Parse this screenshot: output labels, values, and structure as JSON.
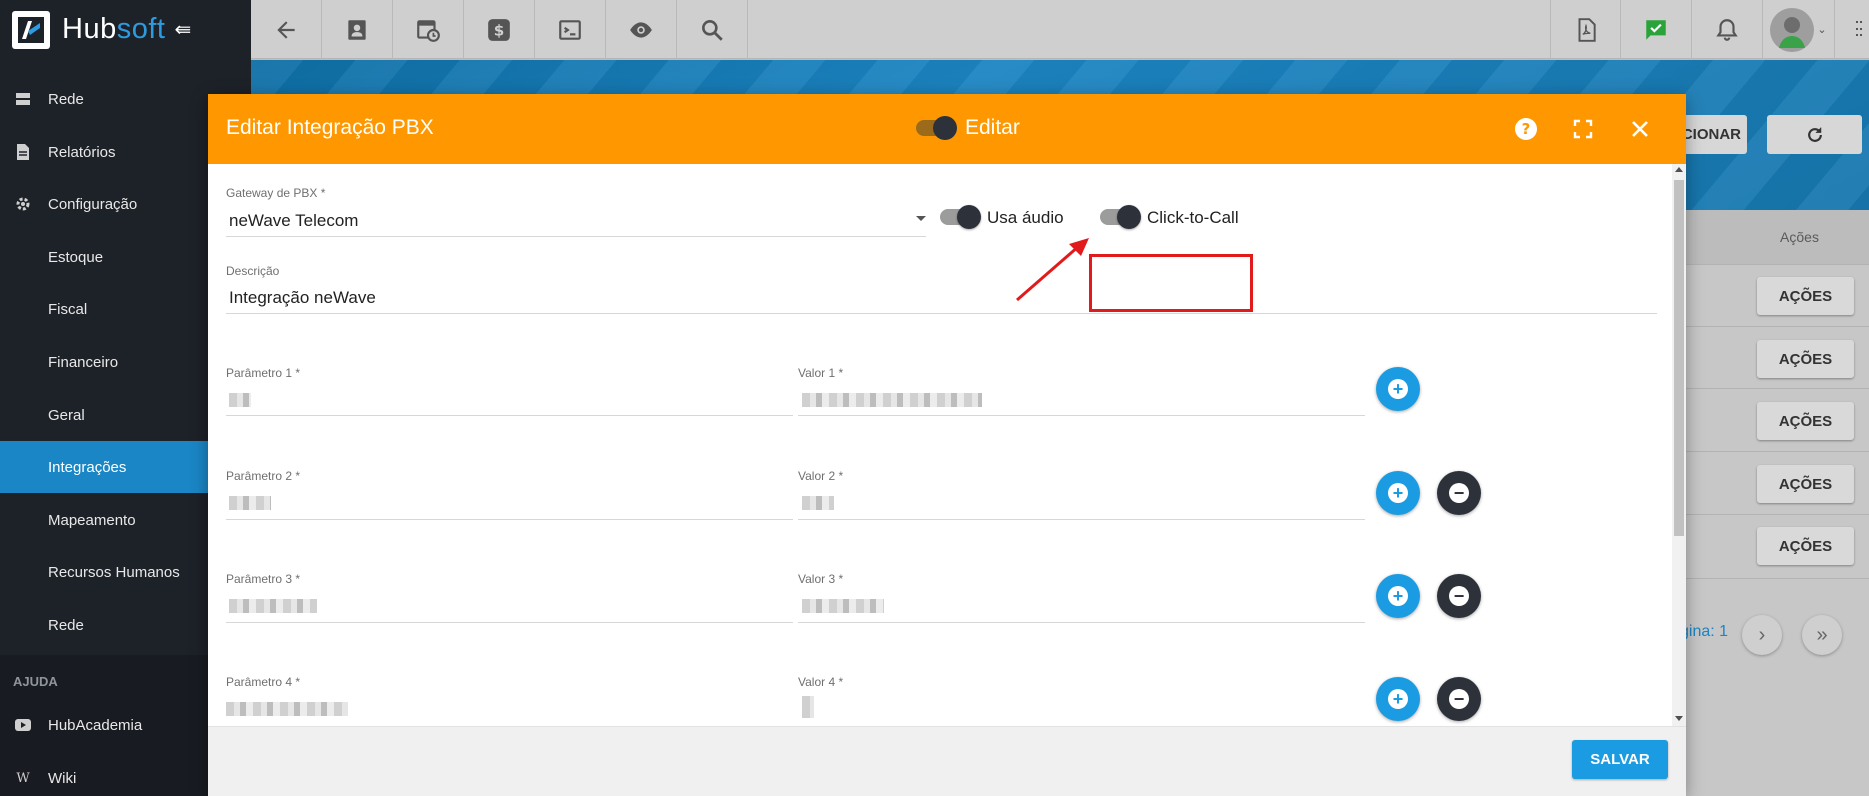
{
  "brand": {
    "name_part1": "Hub",
    "name_part2": "soft",
    "collapse_glyph": "⇚"
  },
  "topbar": {
    "buttons": [
      "back-arrow-icon",
      "contact-card-icon",
      "calendar-clock-icon",
      "dollar-icon",
      "terminal-icon",
      "eye-icon",
      "search-icon"
    ],
    "right_buttons": [
      "pdf-icon",
      "chat-check-icon",
      "bell-icon",
      "avatar"
    ],
    "colors": {
      "chat_check": "#2aa43a"
    }
  },
  "sidebar": {
    "items": [
      {
        "label": "Rede",
        "icon": "server-icon"
      },
      {
        "label": "Relatórios",
        "icon": "document-icon"
      },
      {
        "label": "Configuração",
        "icon": "gear-icon"
      },
      {
        "label": "Estoque"
      },
      {
        "label": "Fiscal"
      },
      {
        "label": "Financeiro"
      },
      {
        "label": "Geral"
      },
      {
        "label": "Integrações",
        "active": true
      },
      {
        "label": "Mapeamento"
      },
      {
        "label": "Recursos Humanos"
      },
      {
        "label": "Rede"
      }
    ],
    "section_help": "AJUDA",
    "help_items": [
      {
        "label": "HubAcademia",
        "icon": "youtube-icon"
      },
      {
        "label": "Wiki",
        "icon": "wikipedia-icon"
      }
    ],
    "colors": {
      "background": "#1d2128",
      "active": "#1a86c5"
    }
  },
  "background_page": {
    "adicionar_label": "ADICIONAR",
    "adicionar_visible": "CIONAR",
    "acoes_header": "Ações",
    "acoes_buttons": [
      "AÇÕES",
      "AÇÕES",
      "AÇÕES",
      "AÇÕES",
      "AÇÕES"
    ],
    "pagina_label": "gina: 1"
  },
  "modal": {
    "title": "Editar Integração PBX",
    "mode_label": "Editar",
    "mode_toggle_on": true,
    "header_icons": [
      "help-icon",
      "fullscreen-icon",
      "close-icon"
    ],
    "colors": {
      "header": "#ff9800",
      "primary": "#1a9be2",
      "highlight": "#e11b1b"
    },
    "gateway": {
      "label": "Gateway de PBX *",
      "value": "neWave Telecom"
    },
    "usa_audio": {
      "label": "Usa áudio",
      "on": true
    },
    "click_to_call": {
      "label": "Click-to-Call",
      "on": true
    },
    "descricao": {
      "label": "Descrição",
      "value": "Integração neWave"
    },
    "params": [
      {
        "param_label": "Parâmetro 1 *",
        "valor_label": "Valor 1 *"
      },
      {
        "param_label": "Parâmetro 2 *",
        "valor_label": "Valor 2 *"
      },
      {
        "param_label": "Parâmetro 3 *",
        "valor_label": "Valor 3 *"
      },
      {
        "param_label": "Parâmetro 4 *",
        "valor_label": "Valor 4 *"
      }
    ],
    "save_label": "SALVAR"
  }
}
